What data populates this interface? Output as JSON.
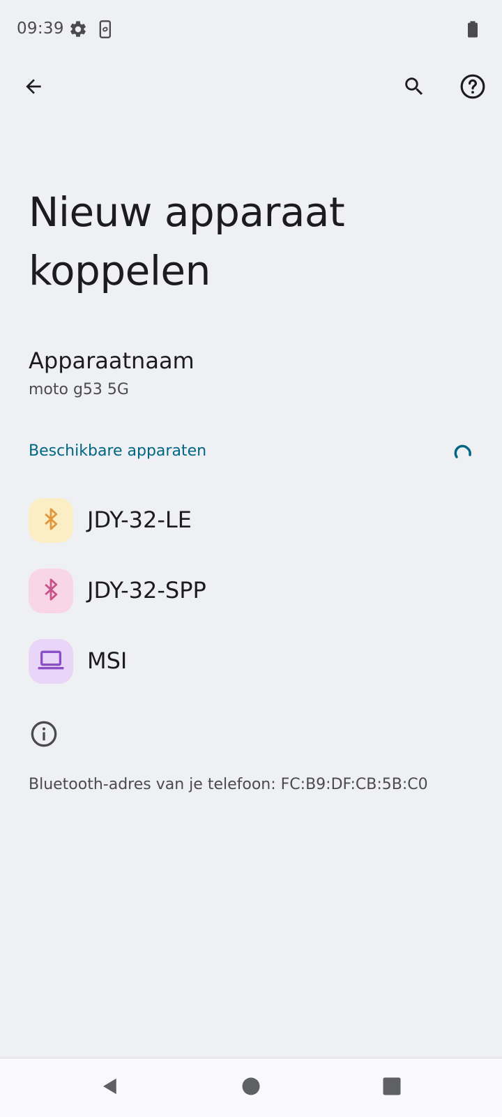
{
  "status_bar": {
    "time": "09:39",
    "icons": [
      "settings-gear-icon",
      "phone-sync-icon",
      "battery-icon"
    ]
  },
  "app_bar": {
    "back_icon": "arrow-back-icon",
    "search_icon": "search-icon",
    "help_icon": "help-circle-icon"
  },
  "title": "Nieuw apparaat koppelen",
  "device_name": {
    "label": "Apparaatnaam",
    "value": "moto g53 5G"
  },
  "available": {
    "header": "Beschikbare apparaten",
    "devices": [
      {
        "name": "JDY-32-LE",
        "icon": "bluetooth-icon",
        "icon_color": "#e2973a",
        "bg": "#fbeec5"
      },
      {
        "name": "JDY-32-SPP",
        "icon": "bluetooth-icon",
        "icon_color": "#c7538a",
        "bg": "#f9d5e8"
      },
      {
        "name": "MSI",
        "icon": "laptop-icon",
        "icon_color": "#8a4fc4",
        "bg": "#e8d5f7"
      }
    ]
  },
  "footer": {
    "bt_address": "Bluetooth-adres van je telefoon: FC:B9:DF:CB:5B:C0"
  },
  "colors": {
    "background": "#eff0f3",
    "accent": "#006684",
    "nav_background": "#f9f9fb"
  }
}
